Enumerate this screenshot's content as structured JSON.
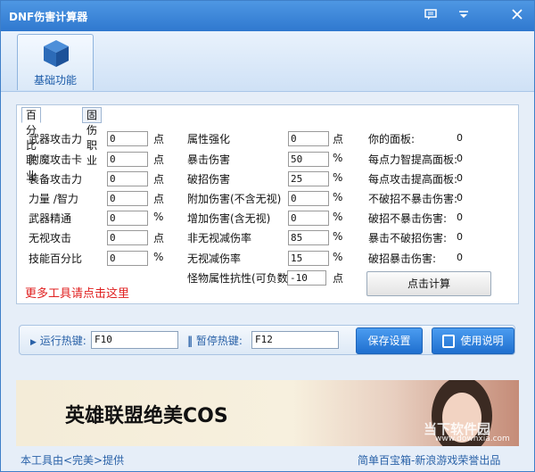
{
  "window": {
    "title": "DNF伤害计算器"
  },
  "toolbar": {
    "basic_label": "基础功能"
  },
  "tabs": [
    "百分比职业",
    "固伤职业"
  ],
  "col1": [
    {
      "label": "武器攻击力",
      "value": "0",
      "unit": "点"
    },
    {
      "label": "附魔攻击卡",
      "value": "0",
      "unit": "点"
    },
    {
      "label": "装备攻击力",
      "value": "0",
      "unit": "点"
    },
    {
      "label": "力量 /智力",
      "value": "0",
      "unit": "点"
    },
    {
      "label": "武器精通",
      "value": "0",
      "unit": "%"
    },
    {
      "label": "无视攻击",
      "value": "0",
      "unit": "点"
    },
    {
      "label": "技能百分比",
      "value": "0",
      "unit": "%"
    }
  ],
  "col2": [
    {
      "label": "属性强化",
      "value": "0",
      "unit": "点"
    },
    {
      "label": "暴击伤害",
      "value": "50",
      "unit": "%"
    },
    {
      "label": "破招伤害",
      "value": "25",
      "unit": "%"
    },
    {
      "label": "附加伤害(不含无视)",
      "value": "0",
      "unit": "%"
    },
    {
      "label": "增加伤害(含无视)",
      "value": "0",
      "unit": "%"
    },
    {
      "label": "非无视减伤率",
      "value": "85",
      "unit": "%"
    },
    {
      "label": "无视减伤率",
      "value": "15",
      "unit": "%"
    },
    {
      "label": "怪物属性抗性(可负数)",
      "value": "-10",
      "unit": "点"
    }
  ],
  "col3": [
    {
      "label": "你的面板:",
      "value": "0"
    },
    {
      "label": "每点力智提高面板:",
      "value": "0"
    },
    {
      "label": "每点攻击提高面板:",
      "value": "0"
    },
    {
      "label": "不破招不暴击伤害:",
      "value": "0"
    },
    {
      "label": "破招不暴击伤害:",
      "value": "0"
    },
    {
      "label": "暴击不破招伤害:",
      "value": "0"
    },
    {
      "label": "破招暴击伤害:",
      "value": "0"
    }
  ],
  "calc_label": "点击计算",
  "more_tools": "更多工具请点击这里",
  "hotkeys": {
    "run_label": "运行热键:",
    "run_value": "F10",
    "pause_label": "暂停热键:",
    "pause_value": "F12",
    "save_label": "保存设置",
    "help_label": "使用说明"
  },
  "banner": {
    "text": "英雄联盟绝美COS",
    "watermark": "当下软件园",
    "watermark_url": "www.downxia.com"
  },
  "footer": {
    "left": "本工具由<完美>提供",
    "right": "简单百宝箱-新浪游戏荣誉出品"
  }
}
